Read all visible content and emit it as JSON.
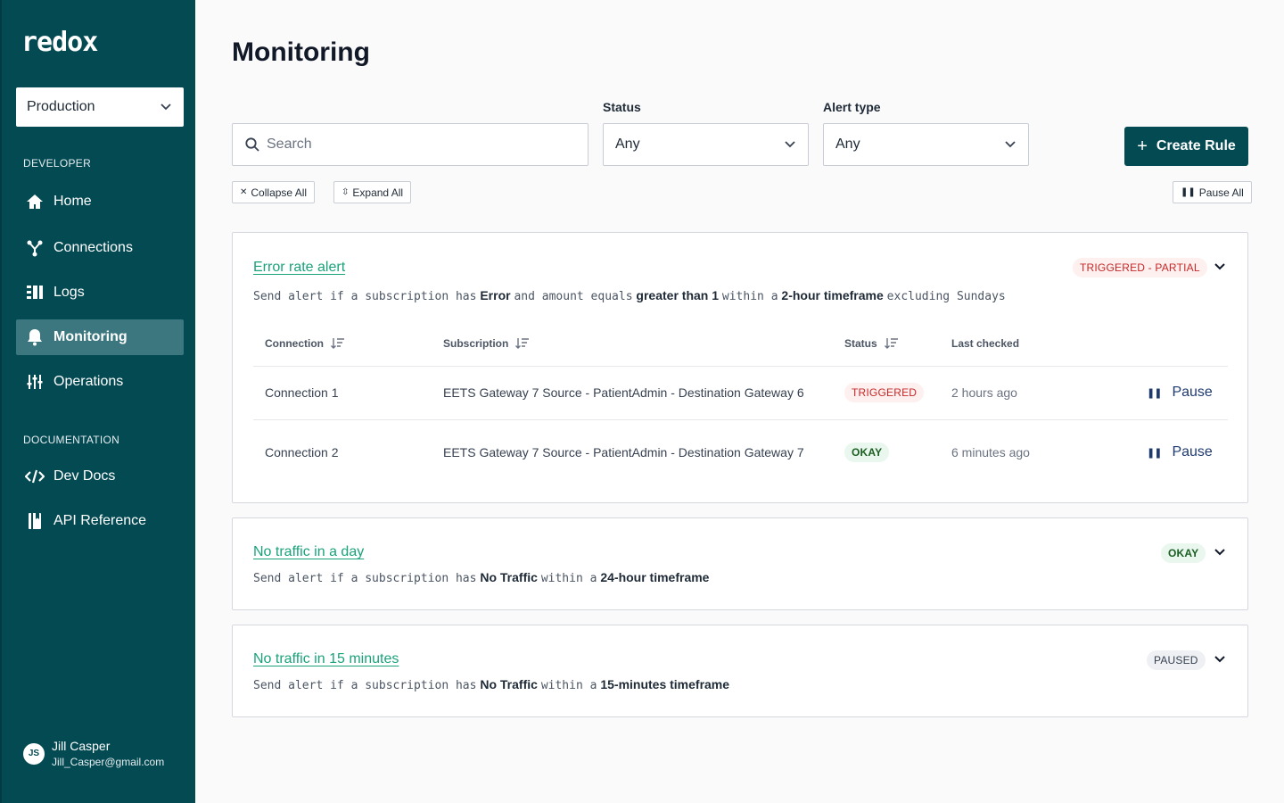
{
  "sidebar": {
    "logo": "redox",
    "environment": "Production",
    "sections": {
      "developer": "DEVELOPER",
      "documentation": "DOCUMENTATION"
    },
    "nav": [
      {
        "label": "Home",
        "icon": "home-icon"
      },
      {
        "label": "Connections",
        "icon": "connections-icon"
      },
      {
        "label": "Logs",
        "icon": "logs-icon"
      },
      {
        "label": "Monitoring",
        "icon": "bell-icon",
        "active": true
      },
      {
        "label": "Operations",
        "icon": "sliders-icon"
      }
    ],
    "docs": [
      {
        "label": "Dev Docs",
        "icon": "code-icon"
      },
      {
        "label": "API Reference",
        "icon": "book-icon"
      }
    ],
    "user": {
      "initials": "JS",
      "name": "Jill Casper",
      "email": "Jill_Casper@gmail.com"
    }
  },
  "header": {
    "title": "Monitoring"
  },
  "filters": {
    "search_placeholder": "Search",
    "status_label": "Status",
    "status_value": "Any",
    "alert_type_label": "Alert type",
    "alert_type_value": "Any",
    "create_rule": "Create Rule",
    "collapse_all": "Collapse All",
    "expand_all": "Expand All",
    "pause_all": "Pause All"
  },
  "colors": {
    "sidebar_bg": "#044a53",
    "accent_green": "#1aa37a",
    "triggered_red": "#c62828"
  },
  "alerts": [
    {
      "title": "Error rate alert",
      "status": "TRIGGERED - PARTIAL",
      "rule": {
        "p1": "Send alert if a subscription has",
        "b1": "Error",
        "p2": "and amount equals",
        "b2": "greater than 1",
        "p3": "within a",
        "b3": "2-hour timeframe",
        "p4": "excluding Sundays"
      },
      "table": {
        "headers": {
          "connection": "Connection",
          "subscription": "Subscription",
          "status": "Status",
          "last_checked": "Last checked"
        },
        "rows": [
          {
            "connection": "Connection 1",
            "subscription": "EETS Gateway 7 Source - PatientAdmin - Destination Gateway 6",
            "status": "TRIGGERED",
            "last_checked": "2 hours ago",
            "action": "Pause"
          },
          {
            "connection": "Connection 2",
            "subscription": "EETS Gateway 7 Source - PatientAdmin - Destination Gateway 7",
            "status": "OKAY",
            "last_checked": "6 minutes ago",
            "action": "Pause"
          }
        ]
      }
    },
    {
      "title": "No traffic in a day",
      "status": "OKAY",
      "rule": {
        "p1": "Send alert if a subscription has",
        "b1": "No Traffic",
        "p2": "within a",
        "b2": "24-hour timeframe"
      }
    },
    {
      "title": "No traffic in 15 minutes",
      "status": "PAUSED",
      "rule": {
        "p1": "Send alert if a subscription has",
        "b1": "No Traffic",
        "p2": "within a",
        "b2": "15-minutes timeframe"
      }
    }
  ]
}
